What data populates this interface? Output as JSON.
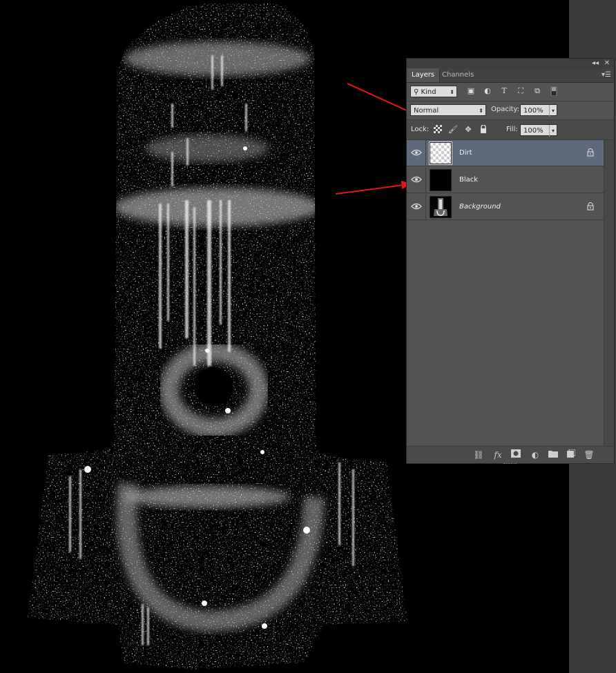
{
  "panel": {
    "tabs": [
      {
        "label": "Layers"
      },
      {
        "label": "Channels"
      }
    ],
    "filter": {
      "kind_label": "Kind",
      "icons": [
        "pixel-filter-icon",
        "adjustment-filter-icon",
        "type-filter-icon",
        "shape-filter-icon",
        "smart-object-filter-icon",
        "filter-toggle-icon"
      ]
    },
    "blend": {
      "mode": "Normal",
      "opacity_label": "Opacity:",
      "opacity_value": "100%"
    },
    "lock": {
      "label": "Lock:",
      "fill_label": "Fill:",
      "fill_value": "100%",
      "icons": [
        "lock-transparent-icon",
        "lock-image-icon",
        "lock-position-icon",
        "lock-all-icon"
      ]
    },
    "layers": [
      {
        "name": "Dirt",
        "visible": true,
        "selected": true,
        "locked": true,
        "thumb": "transparent"
      },
      {
        "name": "Black",
        "visible": true,
        "selected": false,
        "locked": false,
        "thumb": "black"
      },
      {
        "name": "Background",
        "visible": true,
        "selected": false,
        "locked": true,
        "thumb": "image"
      }
    ],
    "bottom_icons": [
      "link-layers-icon",
      "fx-icon",
      "add-mask-icon",
      "adjustment-layer-icon",
      "new-group-icon",
      "new-layer-icon",
      "delete-layer-icon"
    ],
    "fx_text": "fx"
  },
  "colors": {
    "annotation_arrow": "#e8141b",
    "selected_row": "#5e6a7c"
  }
}
